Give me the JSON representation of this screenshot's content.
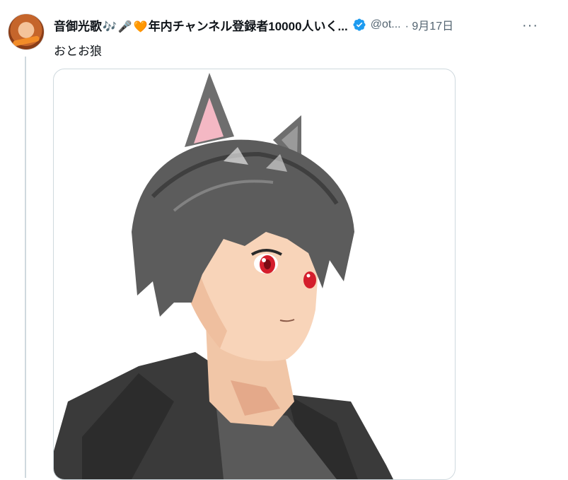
{
  "tweet": {
    "display_name": "音御光歌",
    "emoji_music": "🎶",
    "emoji_mic": "🎤",
    "emoji_heart": "🧡",
    "display_name_rest": "年内チャンネル登録者10000人いく...",
    "handle": "@ot...",
    "date": "· 9月17日",
    "more_label": "···",
    "text": "おとお狼"
  },
  "colors": {
    "verified": "#1d9bf0",
    "text_secondary": "#536471",
    "thread_line": "#cfd9de"
  },
  "icons": [
    "verified-badge-icon",
    "more-options-icon"
  ]
}
